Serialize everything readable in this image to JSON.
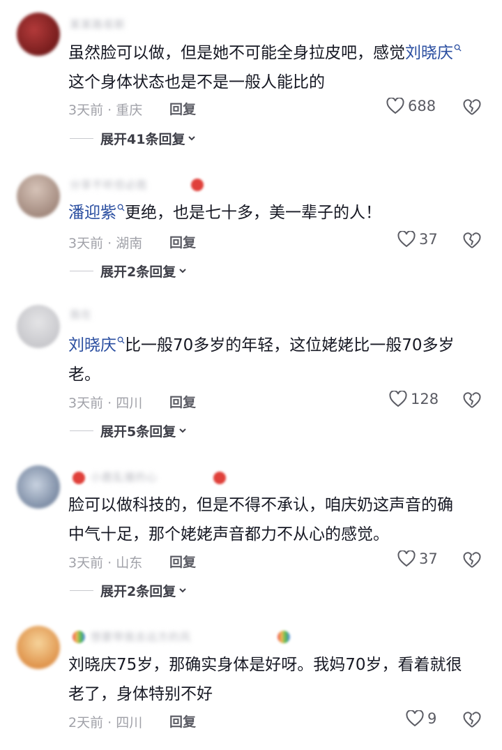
{
  "comments": [
    {
      "username": "某某路易斯",
      "mention": "",
      "text_after": "",
      "text": "虽然脸可以做，但是她不可能全身拉皮吧，感觉",
      "trail_mention": "刘晓庆",
      "text2": "这个身体状态也是不是一般人能比的",
      "time": "3天前 · 重庆",
      "reply": "回复",
      "likes": "688",
      "expand": "展开41条回复",
      "avatar_color": "#7a1e1e"
    },
    {
      "username": "分享不听但必胜",
      "mention": "潘迎紫",
      "text_after": "更绝，也是七十多，美一辈子的人！",
      "time": "3天前 · 湖南",
      "reply": "回复",
      "likes": "37",
      "expand": "展开2条回复",
      "avatar_color": "#b9a49a"
    },
    {
      "username": "我在",
      "mention": "刘晓庆",
      "text_after": "比一般70多岁的年轻，这位姥姥比一般70多岁",
      "text2": "老。",
      "time": "3天前 · 四川",
      "reply": "回复",
      "likes": "128",
      "expand": "展开5条回复",
      "avatar_color": "#cfcfd2"
    },
    {
      "username": "小鹿乱撞的心",
      "text": "脸可以做科技的，但是不得不承认，咱庆奶这声音的确",
      "text2": "中气十足，那个姥姥声音都力不从心的感觉。",
      "time": "3天前 · 山东",
      "reply": "回复",
      "likes": "37",
      "expand": "展开2条回复",
      "avatar_color": "#8e9fb8"
    },
    {
      "username": "想要带我去远方的风",
      "text": "刘晓庆75岁，那确实身体是好呀。我妈70岁，看着就很",
      "text2": "老了，身体特别不好",
      "time": "2天前 · 四川",
      "reply": "回复",
      "likes": "9",
      "avatar_color": "#e8a15e"
    }
  ]
}
